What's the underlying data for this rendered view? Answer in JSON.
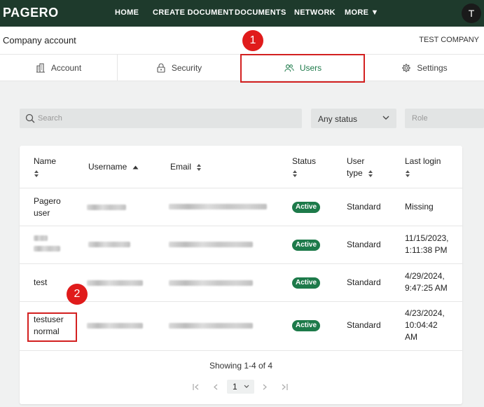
{
  "nav": {
    "logo": "PAGERO",
    "items": [
      "HOME",
      "CREATE DOCUMENT",
      "DOCUMENTS",
      "NETWORK",
      "MORE ▼"
    ],
    "avatar": "T"
  },
  "header": {
    "title": "Company account",
    "company": "TEST COMPANY"
  },
  "tabs": [
    {
      "label": "Account",
      "icon": "building-icon"
    },
    {
      "label": "Security",
      "icon": "lock-icon"
    },
    {
      "label": "Users",
      "icon": "users-icon"
    },
    {
      "label": "Settings",
      "icon": "gear-icon"
    }
  ],
  "annotations": [
    "1",
    "2"
  ],
  "filters": {
    "search_placeholder": "Search",
    "status_value": "Any status",
    "role_placeholder": "Role"
  },
  "table": {
    "headers": {
      "name": "Name",
      "username": "Username",
      "email": "Email",
      "status": "Status",
      "user_type_1": "User",
      "user_type_2": "type",
      "last_login": "Last login"
    },
    "rows": [
      {
        "name1": "Pagero",
        "name2": "user",
        "status": "Active",
        "type": "Standard",
        "login1": "Missing",
        "login2": "",
        "login3": ""
      },
      {
        "name1": "",
        "name2": "",
        "status": "Active",
        "type": "Standard",
        "login1": "11/15/2023,",
        "login2": "1:11:38 PM",
        "login3": ""
      },
      {
        "name1": "test",
        "name2": "",
        "status": "Active",
        "type": "Standard",
        "login1": "4/29/2024,",
        "login2": "9:47:25 AM",
        "login3": ""
      },
      {
        "name1": "testuser",
        "name2": "normal",
        "status": "Active",
        "type": "Standard",
        "login1": "4/23/2024,",
        "login2": "10:04:42",
        "login3": "AM"
      }
    ],
    "footer": "Showing 1-4 of 4",
    "page": "1"
  },
  "colors": {
    "nav_bg": "#1e3a2c",
    "accent": "#1d7a4a",
    "marker": "#e01b1b"
  }
}
